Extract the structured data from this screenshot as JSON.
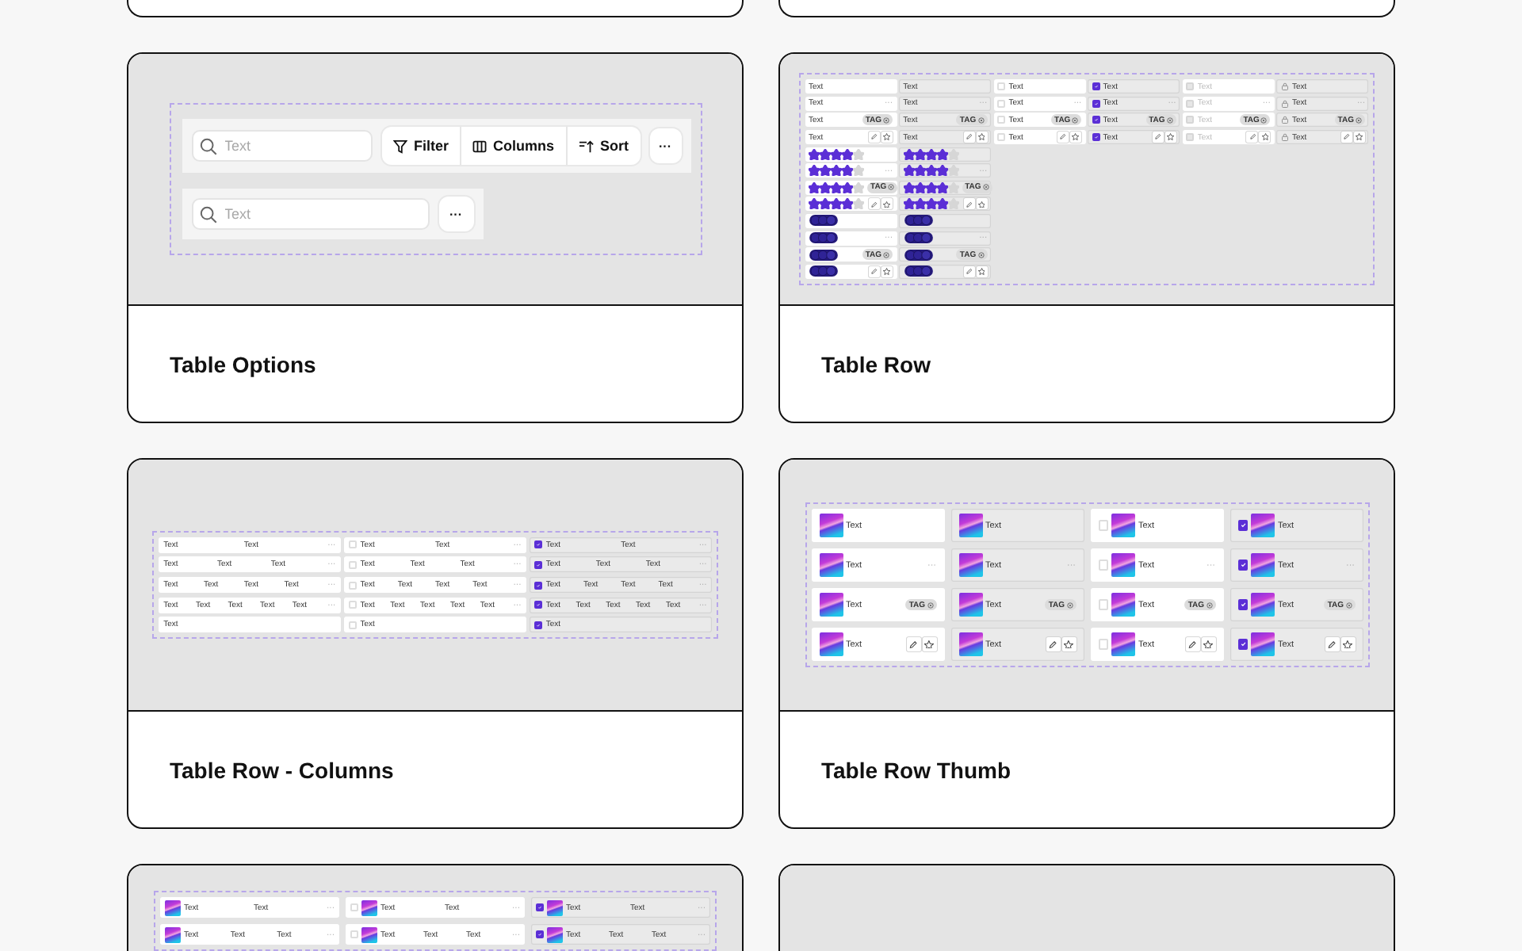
{
  "cards": [
    {
      "kind": "stub"
    },
    {
      "kind": "stub"
    },
    {
      "kind": "card",
      "title": "Table Options",
      "preview": {
        "kind": "options",
        "toolbars": [
          {
            "search": {
              "placeholder": "Text"
            },
            "buttons": [
              {
                "label": "Filter"
              },
              {
                "label": "Columns"
              },
              {
                "label": "Sort"
              }
            ],
            "more": "···"
          },
          {
            "search": {
              "placeholder": "Text"
            },
            "more": "···"
          }
        ]
      }
    },
    {
      "kind": "card",
      "title": "Table Row",
      "preview": {
        "kind": "rows",
        "columns": [
          {
            "kind": "plain",
            "hovered": false,
            "rows": [
              {
                "kind": "text",
                "label": "Text"
              },
              {
                "kind": "text",
                "label": "Text",
                "more": "···"
              },
              {
                "kind": "text",
                "label": "Text",
                "tag": "TAG"
              },
              {
                "kind": "text",
                "label": "Text",
                "actions": true
              },
              {
                "kind": "stars",
                "stars": 4
              },
              {
                "kind": "stars",
                "stars": 4,
                "more": "···"
              },
              {
                "kind": "stars",
                "stars": 4,
                "tag": "TAG"
              },
              {
                "kind": "stars",
                "stars": 4,
                "actions": true
              },
              {
                "kind": "avatars"
              },
              {
                "kind": "avatars",
                "more": "···"
              },
              {
                "kind": "avatars",
                "tag": "TAG"
              },
              {
                "kind": "avatars",
                "actions": true
              }
            ]
          },
          {
            "kind": "plain",
            "hovered": true,
            "rows": [
              {
                "kind": "text",
                "label": "Text"
              },
              {
                "kind": "text",
                "label": "Text",
                "more": "···"
              },
              {
                "kind": "text",
                "label": "Text",
                "tag": "TAG"
              },
              {
                "kind": "text",
                "label": "Text",
                "actions": true
              },
              {
                "kind": "stars",
                "stars": 4
              },
              {
                "kind": "stars",
                "stars": 4,
                "more": "···"
              },
              {
                "kind": "stars",
                "stars": 4,
                "tag": "TAG"
              },
              {
                "kind": "stars",
                "stars": 4,
                "actions": true
              },
              {
                "kind": "avatars"
              },
              {
                "kind": "avatars",
                "more": "···"
              },
              {
                "kind": "avatars",
                "tag": "TAG"
              },
              {
                "kind": "avatars",
                "actions": true
              }
            ]
          },
          {
            "kind": "checkbox",
            "checked": false,
            "hovered": false,
            "rows": [
              {
                "kind": "text",
                "label": "Text"
              },
              {
                "kind": "text",
                "label": "Text",
                "more": "···"
              },
              {
                "kind": "text",
                "label": "Text",
                "tag": "TAG"
              },
              {
                "kind": "text",
                "label": "Text",
                "actions": true
              }
            ]
          },
          {
            "kind": "checkbox",
            "checked": true,
            "hovered": true,
            "rows": [
              {
                "kind": "text",
                "label": "Text"
              },
              {
                "kind": "text",
                "label": "Text",
                "more": "···"
              },
              {
                "kind": "text",
                "label": "Text",
                "tag": "TAG"
              },
              {
                "kind": "text",
                "label": "Text",
                "actions": true
              }
            ]
          },
          {
            "kind": "disabled",
            "hovered": false,
            "rows": [
              {
                "kind": "text",
                "label": "Text"
              },
              {
                "kind": "text",
                "label": "Text",
                "more": "···"
              },
              {
                "kind": "text",
                "label": "Text",
                "tag": "TAG"
              },
              {
                "kind": "text",
                "label": "Text",
                "actions": true
              }
            ]
          },
          {
            "kind": "locked",
            "hovered": true,
            "rows": [
              {
                "kind": "text",
                "label": "Text"
              },
              {
                "kind": "text",
                "label": "Text",
                "more": "···"
              },
              {
                "kind": "text",
                "label": "Text",
                "tag": "TAG"
              },
              {
                "kind": "text",
                "label": "Text",
                "actions": true
              }
            ]
          }
        ]
      }
    },
    {
      "kind": "card",
      "title": "Table Row - Columns",
      "preview": {
        "kind": "columns",
        "columns": [
          {
            "kind": "plain",
            "hovered": false,
            "rows": [
              {
                "kind": "cells",
                "cells": [
                  "Text",
                  "Text"
                ],
                "more": "···"
              },
              {
                "kind": "cells",
                "cells": [
                  "Text",
                  "Text",
                  "Text"
                ],
                "more": "···"
              },
              {
                "kind": "cells",
                "cells": [
                  "Text",
                  "Text",
                  "Text",
                  "Text"
                ],
                "more": "···"
              },
              {
                "kind": "cells",
                "cells": [
                  "Text",
                  "Text",
                  "Text",
                  "Text",
                  "Text"
                ],
                "more": "···"
              },
              {
                "kind": "cells",
                "cells": [
                  "Text"
                ]
              }
            ]
          },
          {
            "kind": "checkbox",
            "checked": false,
            "hovered": false,
            "rows": [
              {
                "kind": "cells",
                "cells": [
                  "Text",
                  "Text"
                ],
                "more": "···"
              },
              {
                "kind": "cells",
                "cells": [
                  "Text",
                  "Text",
                  "Text"
                ],
                "more": "···"
              },
              {
                "kind": "cells",
                "cells": [
                  "Text",
                  "Text",
                  "Text",
                  "Text"
                ],
                "more": "···"
              },
              {
                "kind": "cells",
                "cells": [
                  "Text",
                  "Text",
                  "Text",
                  "Text",
                  "Text"
                ],
                "more": "···"
              },
              {
                "kind": "cells",
                "cells": [
                  "Text"
                ]
              }
            ]
          },
          {
            "kind": "checkbox",
            "checked": true,
            "hovered": true,
            "rows": [
              {
                "kind": "cells",
                "cells": [
                  "Text",
                  "Text"
                ],
                "more": "···"
              },
              {
                "kind": "cells",
                "cells": [
                  "Text",
                  "Text",
                  "Text"
                ],
                "more": "···"
              },
              {
                "kind": "cells",
                "cells": [
                  "Text",
                  "Text",
                  "Text",
                  "Text"
                ],
                "more": "···"
              },
              {
                "kind": "cells",
                "cells": [
                  "Text",
                  "Text",
                  "Text",
                  "Text",
                  "Text"
                ],
                "more": "···"
              },
              {
                "kind": "cells",
                "cells": [
                  "Text"
                ]
              }
            ]
          }
        ]
      }
    },
    {
      "kind": "card",
      "title": "Table Row Thumb",
      "preview": {
        "kind": "thumbs",
        "columns": [
          {
            "kind": "plain",
            "hovered": false,
            "rows": [
              {
                "kind": "text",
                "label": "Text"
              },
              {
                "kind": "text",
                "label": "Text",
                "more": "···"
              },
              {
                "kind": "text",
                "label": "Text",
                "tag": "TAG"
              },
              {
                "kind": "text",
                "label": "Text",
                "actions": true
              }
            ]
          },
          {
            "kind": "plain",
            "hovered": true,
            "rows": [
              {
                "kind": "text",
                "label": "Text"
              },
              {
                "kind": "text",
                "label": "Text",
                "more": "···"
              },
              {
                "kind": "text",
                "label": "Text",
                "tag": "TAG"
              },
              {
                "kind": "text",
                "label": "Text",
                "actions": true
              }
            ]
          },
          {
            "kind": "checkbox",
            "checked": false,
            "hovered": false,
            "rows": [
              {
                "kind": "text",
                "label": "Text"
              },
              {
                "kind": "text",
                "label": "Text",
                "more": "···"
              },
              {
                "kind": "text",
                "label": "Text",
                "tag": "TAG"
              },
              {
                "kind": "text",
                "label": "Text",
                "actions": true
              }
            ]
          },
          {
            "kind": "checkbox",
            "checked": true,
            "hovered": true,
            "rows": [
              {
                "kind": "text",
                "label": "Text"
              },
              {
                "kind": "text",
                "label": "Text",
                "more": "···"
              },
              {
                "kind": "text",
                "label": "Text",
                "tag": "TAG"
              },
              {
                "kind": "text",
                "label": "Text",
                "actions": true
              }
            ]
          }
        ]
      }
    },
    {
      "kind": "card",
      "preview": {
        "kind": "thumb-columns",
        "columns": [
          {
            "kind": "plain",
            "hovered": false,
            "rows": [
              {
                "kind": "cells",
                "cells": [
                  "Text",
                  "Text"
                ],
                "more": "···"
              },
              {
                "kind": "cells",
                "cells": [
                  "Text",
                  "Text",
                  "Text"
                ],
                "more": "···"
              }
            ]
          },
          {
            "kind": "checkbox",
            "checked": false,
            "hovered": false,
            "rows": [
              {
                "kind": "cells",
                "cells": [
                  "Text",
                  "Text"
                ],
                "more": "···"
              },
              {
                "kind": "cells",
                "cells": [
                  "Text",
                  "Text",
                  "Text"
                ],
                "more": "···"
              }
            ]
          },
          {
            "kind": "checkbox",
            "checked": true,
            "hovered": true,
            "rows": [
              {
                "kind": "cells",
                "cells": [
                  "Text",
                  "Text"
                ],
                "more": "···"
              },
              {
                "kind": "cells",
                "cells": [
                  "Text",
                  "Text",
                  "Text"
                ],
                "more": "···"
              }
            ]
          }
        ]
      }
    },
    {
      "kind": "card",
      "preview": {
        "kind": "empty"
      }
    }
  ]
}
